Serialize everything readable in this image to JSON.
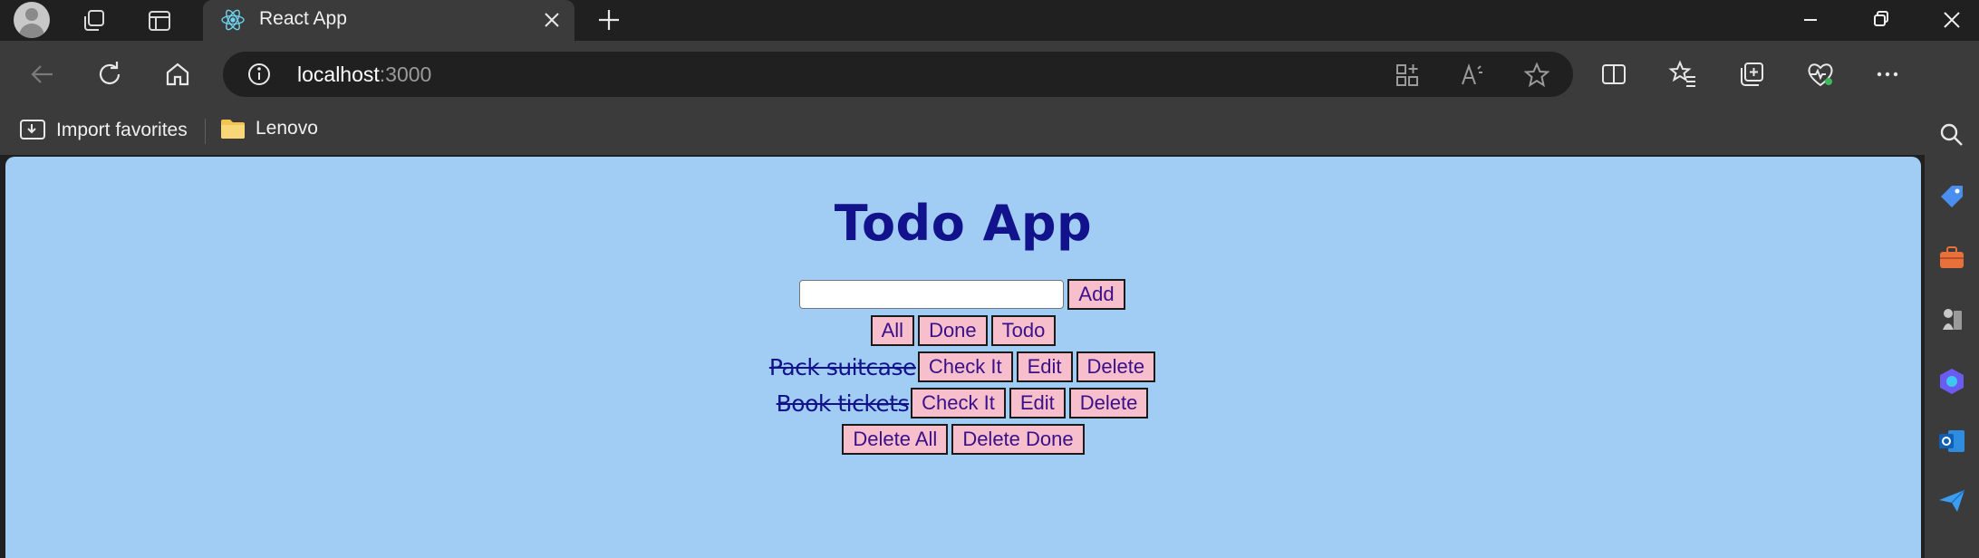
{
  "browser": {
    "tab_title": "React App",
    "url_host": "localhost",
    "url_port": ":3000",
    "bookmarks": [
      "Import favorites",
      "Lenovo"
    ]
  },
  "app": {
    "title": "Todo App",
    "input_value": "",
    "add_label": "Add",
    "filters": [
      "All",
      "Done",
      "Todo"
    ],
    "todos": [
      {
        "text": "Pack suitcase",
        "done": true,
        "actions": [
          "Check It",
          "Edit",
          "Delete"
        ]
      },
      {
        "text": "Book tickets",
        "done": true,
        "actions": [
          "Check It",
          "Edit",
          "Delete"
        ]
      }
    ],
    "bulk_actions": [
      "Delete All",
      "Delete Done"
    ]
  },
  "colors": {
    "page_bg": "#a1cdf4",
    "title": "#12128c",
    "button_bg": "#f7bfcb",
    "button_text": "#3a108a"
  },
  "icons": {
    "sidebar": [
      "search-icon",
      "tag-icon",
      "briefcase-icon",
      "chess-icon",
      "copilot-icon",
      "outlook-icon",
      "send-icon"
    ]
  }
}
